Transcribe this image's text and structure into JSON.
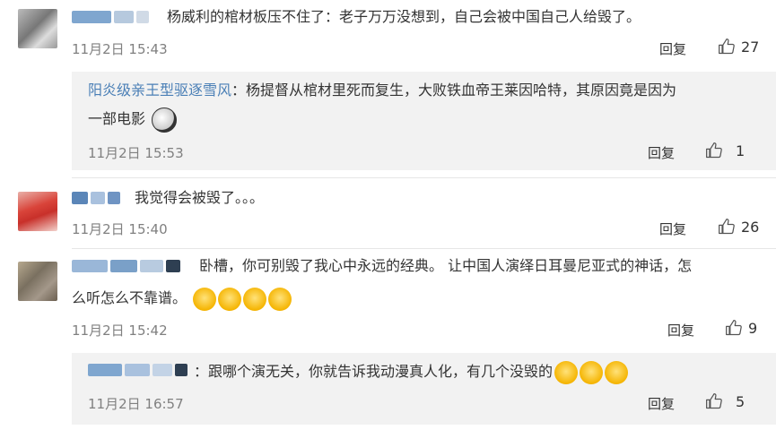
{
  "comments": [
    {
      "text": "杨威利的棺材板压不住了：老子万万没想到，自己会被中国自己人给毁了。",
      "time": "11月2日 15:43",
      "reply_label": "回复",
      "likes": "27",
      "subreply": {
        "username": "阳炎级亲王型驱逐雪风",
        "text_line1": "：杨提督从棺材里死而复生，大败铁血帝王莱因哈特，其原因竟是因为",
        "text_line2": "一部电影",
        "time": "11月2日 15:53",
        "reply_label": "回复",
        "likes": "1"
      }
    },
    {
      "text": "我觉得会被毁了。。。",
      "time": "11月2日 15:40",
      "reply_label": "回复",
      "likes": "26"
    },
    {
      "text_line1": "卧槽，你可别毁了我心中永远的经典。  让中国人演绎日耳曼尼亚式的神话，怎",
      "text_line2": "么听怎么不靠谱。",
      "time": "11月2日 15:42",
      "reply_label": "回复",
      "likes": "9",
      "subreply": {
        "text": "：跟哪个演无关，你就告诉我动漫真人化，有几个没毁的",
        "time": "11月2日 16:57",
        "reply_label": "回复",
        "likes": "5"
      }
    }
  ],
  "colors": {
    "username_link": "#4a7fb6",
    "subreply_bg": "#f2f2f2",
    "meta": "#808080"
  },
  "icons": {
    "like": "thumbs-up-icon",
    "emoji": "smiley-icon"
  }
}
